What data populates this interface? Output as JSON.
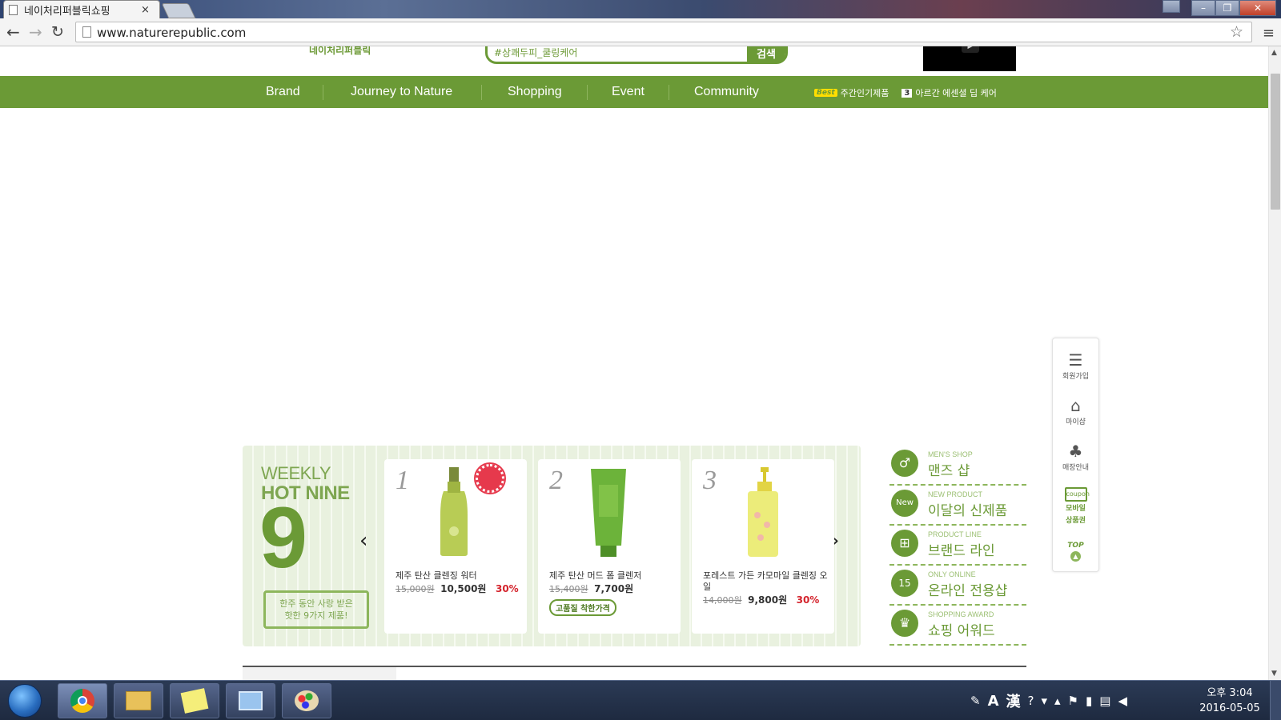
{
  "browser": {
    "tab_title": "네이처리퍼블릭쇼핑",
    "tab_close": "×",
    "url": "www.naturerepublic.com",
    "controls": {
      "minimize": "–",
      "restore": "❐",
      "close": "✕"
    }
  },
  "header": {
    "brand_name": "네이처리퍼블릭",
    "search_value": "#상쾌두피_쿨링케어",
    "search_button": "검색"
  },
  "gnb": {
    "items": [
      "Brand",
      "Journey to Nature",
      "Shopping",
      "Event",
      "Community"
    ],
    "ticker": {
      "best_label": "Best",
      "best_text": "주간인기제품",
      "rank": "3",
      "product": "아르간 에센셜 딥 케어"
    }
  },
  "hot_nine": {
    "weekly": "WEEKLY",
    "title": "HOT NINE",
    "number": "9",
    "desc_line1": "한주 동안 사랑 받은",
    "desc_line2": "핫한 9가지 제품!",
    "products": [
      {
        "rank": "1",
        "name": "제주 탄산 클렌징 워터",
        "old_price": "15,000원",
        "new_price": "10,500원",
        "discount": "30%",
        "tag": ""
      },
      {
        "rank": "2",
        "name": "제주 탄산 머드 폼 클렌저",
        "old_price": "15,400원",
        "new_price": "7,700원",
        "discount": "",
        "tag": "고품질 착한가격"
      },
      {
        "rank": "3",
        "name": "포레스트 가든 카모마일 클렌징 오일",
        "old_price": "14,000원",
        "new_price": "9,800원",
        "discount": "30%",
        "tag": ""
      }
    ]
  },
  "categories": [
    {
      "sub": "MEN'S SHOP",
      "main": "맨즈 샵",
      "icon": "mens-shop-icon"
    },
    {
      "sub": "NEW PRODUCT",
      "main": "이달의 신제품",
      "icon": "new-icon"
    },
    {
      "sub": "PRODUCT LINE",
      "main": "브랜드 라인",
      "icon": "product-line-icon"
    },
    {
      "sub": "ONLY ONLINE",
      "main": "온라인 전용샵",
      "icon": "calendar-icon"
    },
    {
      "sub": "SHOPPING AWARD",
      "main": "쇼핑 어워드",
      "icon": "crown-icon"
    }
  ],
  "quick_menu": {
    "signup": "회원가입",
    "myshop": "마이샵",
    "store": "매장안내",
    "coupon_glyph": "coupon",
    "coupon_l1": "모바일",
    "coupon_l2": "상품권",
    "top": "TOP"
  },
  "taskbar": {
    "time_period": "오후 3:04",
    "date": "2016-05-05",
    "ime_a": "A",
    "ime_han": "漢"
  },
  "colors": {
    "brand_green": "#6b9a36",
    "discount_red": "#d4232c"
  }
}
